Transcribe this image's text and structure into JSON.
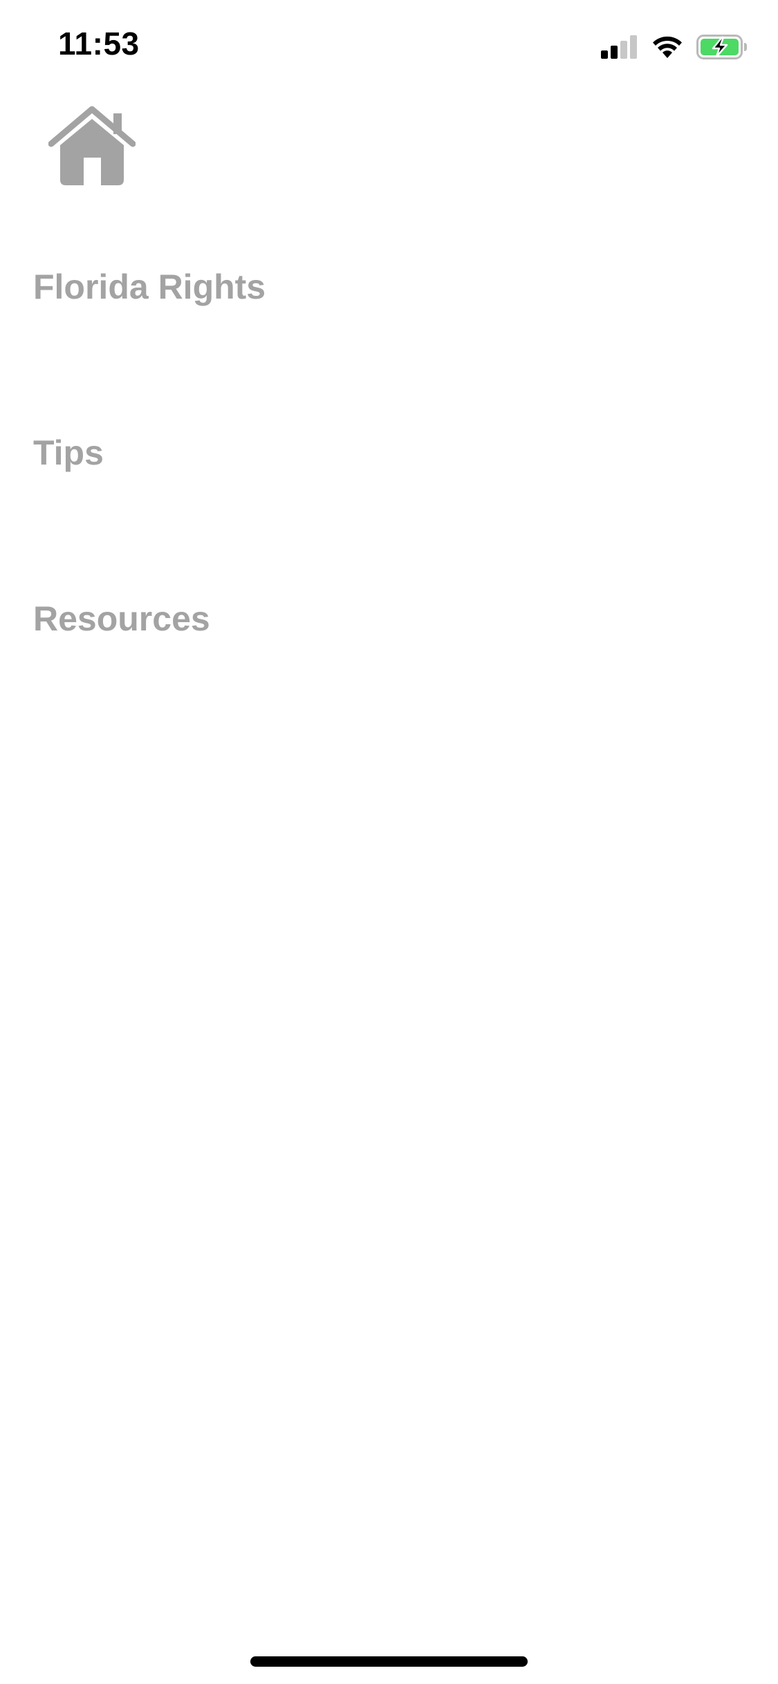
{
  "status_bar": {
    "time": "11:53",
    "signal_icon": "cellular-signal-icon",
    "wifi_icon": "wifi-icon",
    "battery_icon": "battery-charging-icon",
    "battery_color": "#4cd964"
  },
  "home": {
    "icon": "home-icon",
    "color": "#a3a3a3"
  },
  "menu": {
    "items": [
      {
        "label": "Florida Rights"
      },
      {
        "label": "Tips"
      },
      {
        "label": "Resources"
      }
    ]
  },
  "colors": {
    "background": "#ffffff",
    "menu_text": "#a3a3a3"
  }
}
